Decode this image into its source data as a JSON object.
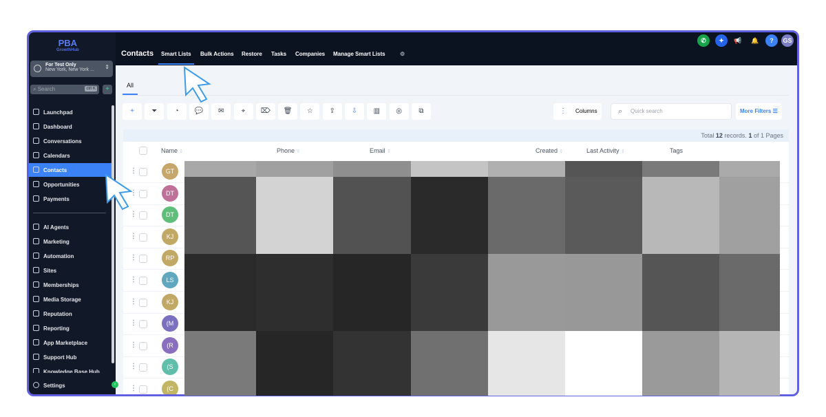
{
  "brand": {
    "name": "PBA",
    "sub": "GrowthHub"
  },
  "account": {
    "name": "For Test Only",
    "location": "New York, New York ..."
  },
  "sidebar_search": {
    "placeholder": "Search",
    "shortcut": "ctrl K"
  },
  "nav": [
    "Launchpad",
    "Dashboard",
    "Conversations",
    "Calendars",
    "Contacts",
    "Opportunities",
    "Payments"
  ],
  "nav2": [
    "AI Agents",
    "Marketing",
    "Automation",
    "Sites",
    "Memberships",
    "Media Storage",
    "Reputation",
    "Reporting",
    "App Marketplace",
    "Support Hub",
    "Knowledge Base Hub"
  ],
  "settings": "Settings",
  "topbar": {
    "title": "Contacts",
    "tabs": [
      "Smart Lists",
      "Bulk Actions",
      "Restore",
      "Tasks",
      "Companies",
      "Manage Smart Lists"
    ],
    "user_initials": "GS",
    "help": "?"
  },
  "subtab": "All",
  "toolbar": {
    "columns": "Columns",
    "quick_search_placeholder": "Quick search",
    "more_filters": "More Filters"
  },
  "summary": {
    "prefix": "Total",
    "count": "12",
    "middle": "records.",
    "page": "1",
    "suffix": "of 1 Pages"
  },
  "columns": [
    "Name",
    "Phone",
    "Email",
    "Created",
    "Last Activity",
    "Tags"
  ],
  "rows": [
    {
      "initials": "GT",
      "color": "#c7a66b"
    },
    {
      "initials": "DT",
      "color": "#c0719a"
    },
    {
      "initials": "DT",
      "color": "#5fbf7a"
    },
    {
      "initials": "KJ",
      "color": "#c2a865"
    },
    {
      "initials": "RP",
      "color": "#c2a865"
    },
    {
      "initials": "LS",
      "color": "#5fa8bf"
    },
    {
      "initials": "KJ",
      "color": "#c2a865"
    },
    {
      "initials": "(M",
      "color": "#7b6fc0"
    },
    {
      "initials": "(R",
      "color": "#8a6fc0"
    },
    {
      "initials": "(S",
      "color": "#5fbfaa"
    },
    {
      "initials": "(C",
      "color": "#c2b665"
    }
  ]
}
